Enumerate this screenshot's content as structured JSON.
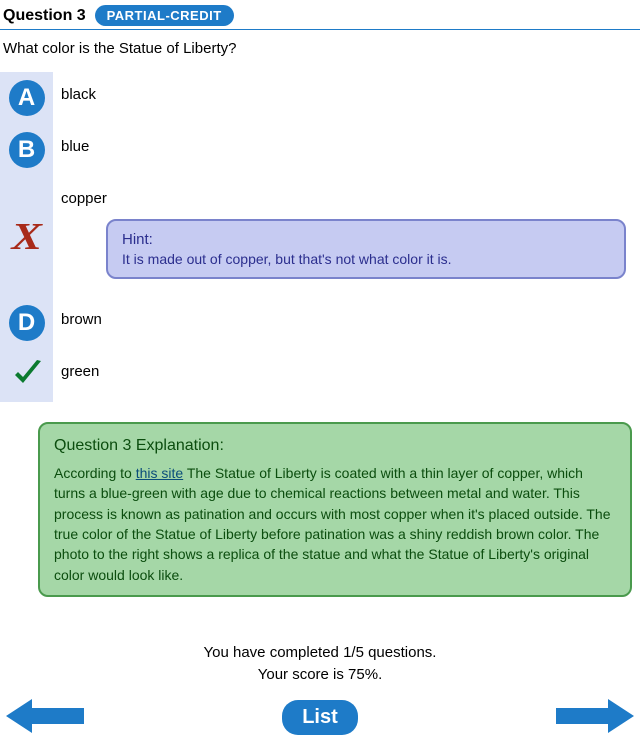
{
  "header": {
    "question_label": "Question 3",
    "badge": "PARTIAL-CREDIT"
  },
  "question_text": "What color is the Statue of Liberty?",
  "options": {
    "a": {
      "letter": "A",
      "label": "black"
    },
    "b": {
      "letter": "B",
      "label": "blue"
    },
    "c": {
      "label": "copper"
    },
    "d": {
      "letter": "D",
      "label": "brown"
    },
    "e": {
      "label": "green"
    }
  },
  "hint": {
    "title": "Hint:",
    "text": "It is made out of copper, but that's not what color it is."
  },
  "explanation": {
    "title": "Question 3 Explanation:",
    "prefix": "According to ",
    "link_text": "this site",
    "body": " The Statue of Liberty is coated with a thin layer of copper, which turns a blue-green with age due to chemical reactions between metal and water. This process is known as patination and occurs with most copper when it's placed outside. The true color of the Statue of Liberty before patination was a shiny reddish brown color. The photo to the right shows a replica of the statue and what the Statue of Liberty's original color would look like."
  },
  "footer": {
    "completed": "You have completed 1/5 questions.",
    "score": "Your score is 75%.",
    "list_label": "List"
  },
  "colors": {
    "primary": "#1e7bc8",
    "hint_bg": "#c6cbf2",
    "hint_border": "#7a83cc",
    "exp_bg": "#a5d7a7",
    "exp_border": "#4a9a4d",
    "wrong": "#a82a1a",
    "correct": "#0b7a2f"
  }
}
